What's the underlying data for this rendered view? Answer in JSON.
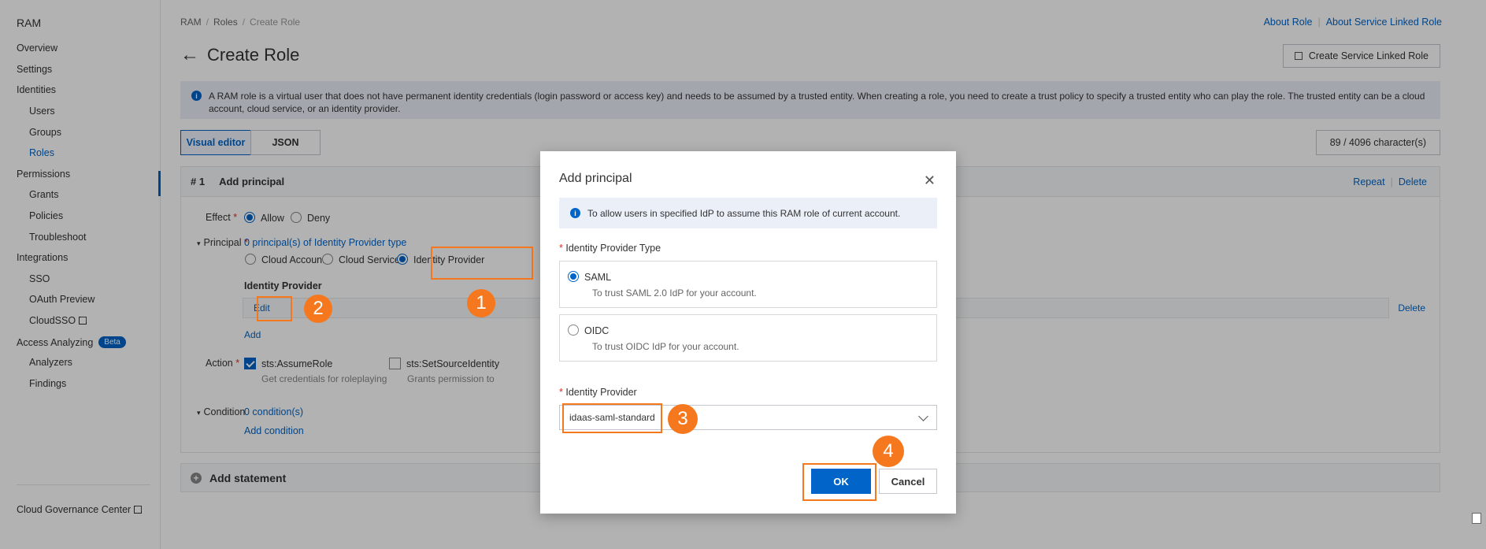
{
  "sidebar": {
    "title": "RAM",
    "items": [
      {
        "label": "Overview",
        "sub": false
      },
      {
        "label": "Settings",
        "sub": false
      },
      {
        "label": "Identities",
        "sub": false
      },
      {
        "label": "Users",
        "sub": true
      },
      {
        "label": "Groups",
        "sub": true
      },
      {
        "label": "Roles",
        "sub": true,
        "active": true
      },
      {
        "label": "Permissions",
        "sub": false
      },
      {
        "label": "Grants",
        "sub": true
      },
      {
        "label": "Policies",
        "sub": true
      },
      {
        "label": "Troubleshoot",
        "sub": true
      },
      {
        "label": "Integrations",
        "sub": false
      },
      {
        "label": "SSO",
        "sub": true
      },
      {
        "label": "OAuth Preview",
        "sub": true
      },
      {
        "label": "CloudSSO",
        "sub": true,
        "external": true
      },
      {
        "label": "Access Analyzing",
        "sub": false,
        "badge": "Beta"
      },
      {
        "label": "Analyzers",
        "sub": true
      },
      {
        "label": "Findings",
        "sub": true
      }
    ],
    "footer_item": "Cloud Governance Center",
    "collapse_glyph": "‹"
  },
  "breadcrumb": [
    "RAM",
    "Roles",
    "Create Role"
  ],
  "breadcrumb_sep": "/",
  "top_links": [
    "About Role",
    "About Service Linked Role"
  ],
  "page_title": "Create Role",
  "create_slr_button": "Create Service Linked Role",
  "notice": "A RAM role is a virtual user that does not have permanent identity credentials (login password or access key) and needs to be assumed by a trusted entity. When creating a role, you need to create a trust policy to specify a trusted entity who can play the role. The trusted entity can be a cloud account, cloud service, or an identity provider.",
  "editor_tabs": [
    "Visual editor",
    "JSON"
  ],
  "char_count": "89 / 4096 character(s)",
  "statement": {
    "number": "# 1",
    "title": "Add principal",
    "repeat": "Repeat",
    "delete": "Delete",
    "effect_label": "Effect",
    "effect_allow": "Allow",
    "effect_deny": "Deny",
    "principal_label": "Principal",
    "principal_summary": "0 principal(s) of Identity Provider type",
    "principal_opts": [
      "Cloud Account",
      "Cloud Service",
      "Identity Provider"
    ],
    "idp_heading": "Identity Provider",
    "edit": "Edit",
    "row_delete": "Delete",
    "add": "Add",
    "action_label": "Action",
    "action1": "sts:AssumeRole",
    "action1_desc": "Get credentials for roleplaying",
    "action2": "sts:SetSourceIdentity",
    "action2_desc": "Grants permission to",
    "condition_label": "Condition",
    "condition_summary": "0 condition(s)",
    "add_condition": "Add condition"
  },
  "add_statement": "Add statement",
  "modal": {
    "title": "Add principal",
    "notice": "To allow users in specified IdP to assume this RAM role of current account.",
    "type_label": "Identity Provider Type",
    "options": [
      {
        "title": "SAML",
        "desc": "To trust SAML 2.0 IdP for your account.",
        "selected": true
      },
      {
        "title": "OIDC",
        "desc": "To trust OIDC IdP for your account.",
        "selected": false
      }
    ],
    "idp_label": "Identity Provider",
    "idp_value": "idaas-saml-standard",
    "ok": "OK",
    "cancel": "Cancel"
  },
  "steps": [
    "1",
    "2",
    "3",
    "4"
  ],
  "colors": {
    "accent": "#0064c8",
    "highlight": "#f5781e",
    "required": "#d93026"
  }
}
